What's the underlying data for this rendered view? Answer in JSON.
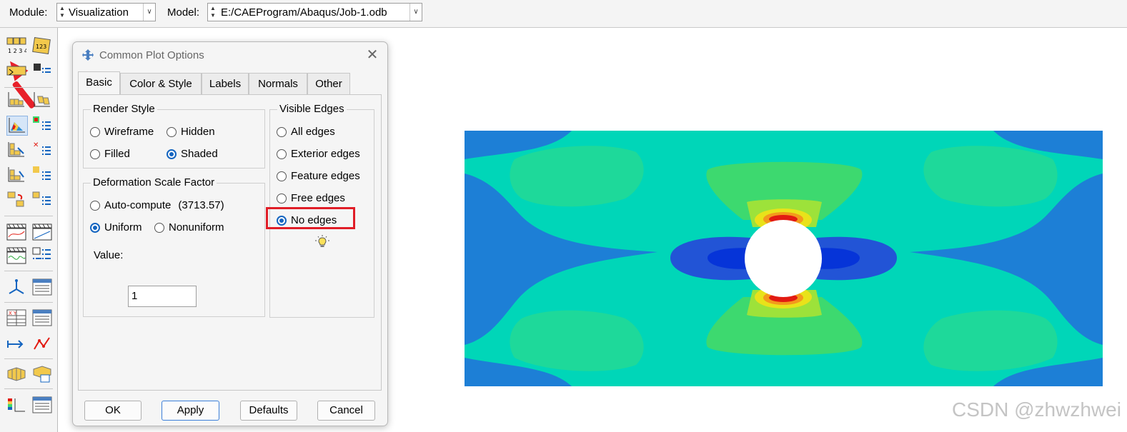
{
  "topbar": {
    "module_label": "Module:",
    "module_value": "Visualization",
    "model_label": "Model:",
    "model_value": "E:/CAEProgram/Abaqus/Job-1.odb"
  },
  "dialog": {
    "title": "Common Plot Options",
    "tabs": [
      "Basic",
      "Color & Style",
      "Labels",
      "Normals",
      "Other"
    ],
    "active_tab": "Basic",
    "render_style": {
      "title": "Render Style",
      "options": [
        "Wireframe",
        "Hidden",
        "Filled",
        "Shaded"
      ],
      "selected": "Shaded"
    },
    "deformation": {
      "title": "Deformation Scale Factor",
      "auto_label": "Auto-compute",
      "auto_value": "(3713.57)",
      "uniform_label": "Uniform",
      "nonuniform_label": "Nonuniform",
      "selected": "Uniform",
      "value_label": "Value:",
      "value": "1"
    },
    "visible_edges": {
      "title": "Visible Edges",
      "options": [
        "All edges",
        "Exterior edges",
        "Feature edges",
        "Free edges",
        "No edges"
      ],
      "selected": "No edges"
    },
    "buttons": {
      "ok": "OK",
      "apply": "Apply",
      "defaults": "Defaults",
      "cancel": "Cancel"
    }
  },
  "watermark": "CSDN @zhwzhwei",
  "colors": {
    "accent": "#1565c0",
    "highlight": "#e01d27",
    "contour_blue": "#1d7fd6",
    "contour_teal": "#00d6b8",
    "contour_green": "#3dd96f",
    "contour_dark_blue": "#0634d8",
    "contour_red": "#e21b12"
  }
}
